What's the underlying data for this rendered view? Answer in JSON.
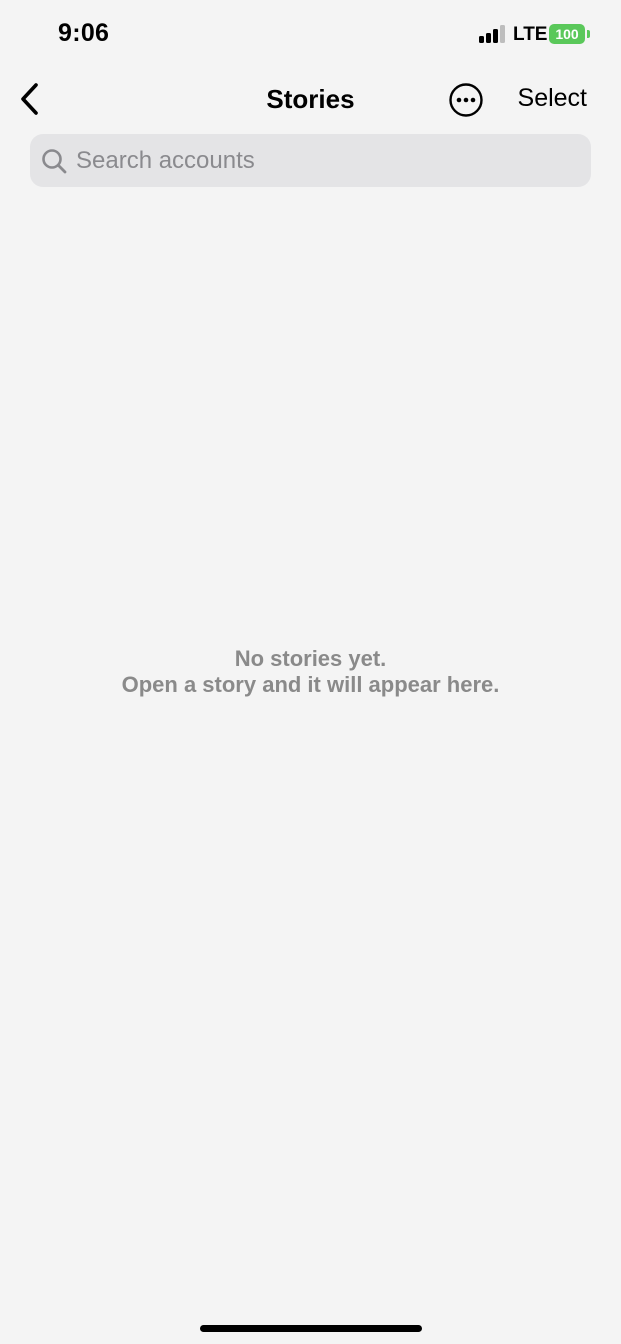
{
  "status_bar": {
    "time": "9:06",
    "network": "LTE",
    "battery": "100"
  },
  "nav": {
    "title": "Stories",
    "select_label": "Select",
    "back_icon": "chevron-left-icon",
    "more_icon": "ellipsis-circle-icon"
  },
  "search": {
    "placeholder": "Search accounts",
    "value": ""
  },
  "empty_state": {
    "line1": "No stories yet.",
    "line2": "Open a story and it will appear here."
  },
  "colors": {
    "background": "#f4f4f4",
    "search_background": "#e4e4e6",
    "battery": "#5ac85a",
    "secondary_text": "#8a8a8a"
  }
}
